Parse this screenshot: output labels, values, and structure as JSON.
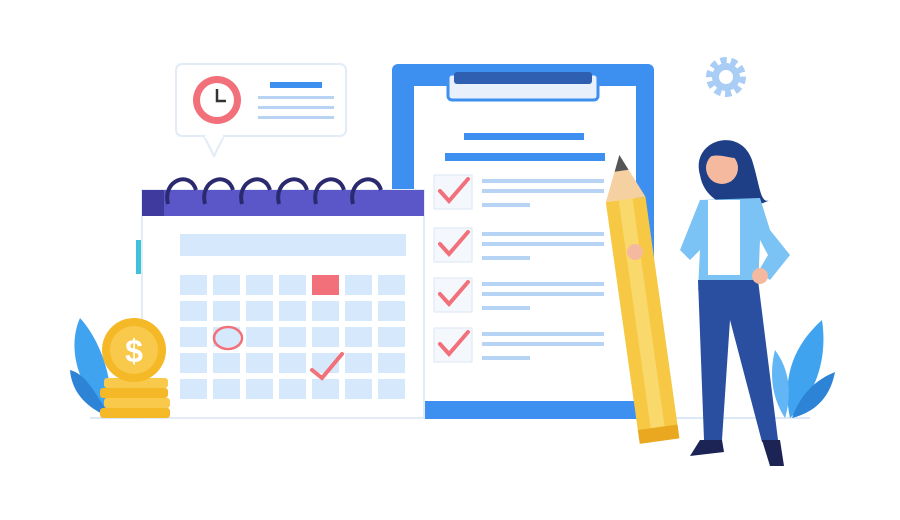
{
  "illustration": {
    "subject": "scheduling-checklist",
    "icons": [
      "clock-icon",
      "calendar-icon",
      "clipboard-icon",
      "checkmark-icon",
      "pencil-icon",
      "gear-icon",
      "coin-icon",
      "leaf-icon",
      "person-figure"
    ]
  },
  "colors": {
    "primary_blue": "#3d8ff0",
    "light_blue": "#d6e8fb",
    "accent_red": "#f2707a",
    "calendar_header": "#5b57c9",
    "pencil_yellow": "#f7c843",
    "coin_gold": "#f5b827",
    "leaf_blue": "#3fa3f0",
    "pants_navy": "#2a4fa0"
  }
}
